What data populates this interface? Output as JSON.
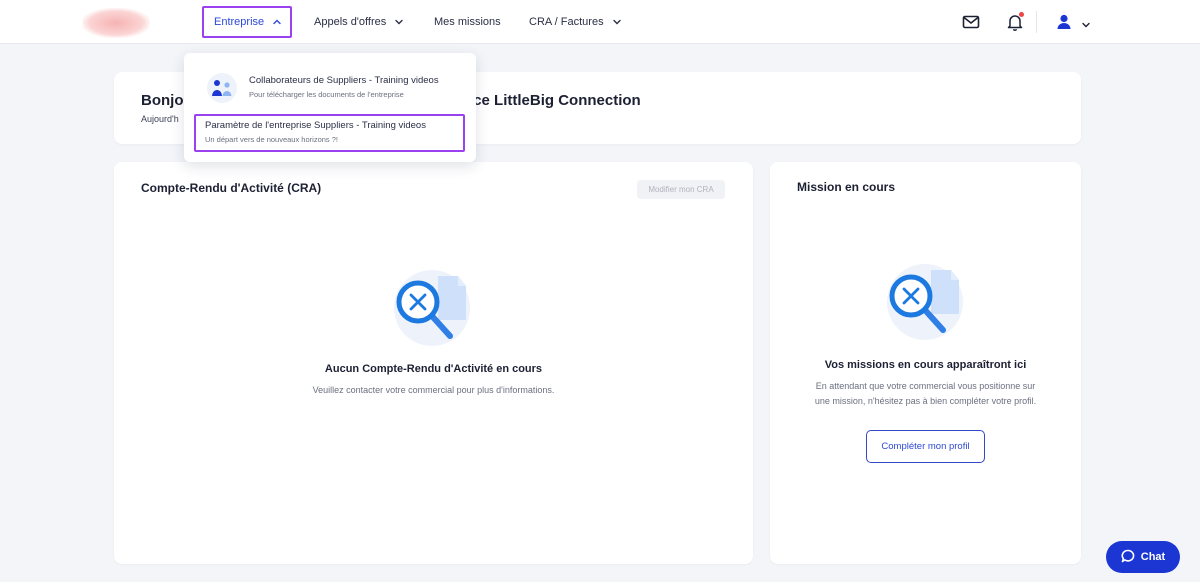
{
  "nav": {
    "items": [
      {
        "label": "Entreprise",
        "active": true
      },
      {
        "label": "Appels d'offres"
      },
      {
        "label": "Mes missions"
      },
      {
        "label": "CRA / Factures"
      }
    ]
  },
  "dropdown": {
    "items": [
      {
        "title": "Collaborateurs de Suppliers - Training videos",
        "subtitle": "Pour télécharger les documents de l'entreprise"
      },
      {
        "title": "Paramètre de l'entreprise Suppliers - Training videos",
        "subtitle": "Un départ vers de nouveaux horizons ?!"
      }
    ]
  },
  "welcome": {
    "title_start": "Bonjo",
    "title_end": "espace LittleBig Connection",
    "subtitle_start": "Aujourd'h"
  },
  "cra": {
    "title": "Compte-Rendu d'Activité (CRA)",
    "modify_button": "Modifier mon CRA",
    "empty_title": "Aucun Compte-Rendu d'Activité en cours",
    "empty_text": "Veuillez contacter votre commercial pour plus d'informations."
  },
  "mission": {
    "title": "Mission en cours",
    "empty_title": "Vos missions en cours apparaîtront ici",
    "empty_text_line1": "En attendant que votre commercial vous positionne sur",
    "empty_text_line2": "une mission, n'hésitez pas à bien compléter votre profil.",
    "profile_button": "Compléter mon profil"
  },
  "chat": {
    "label": "Chat"
  },
  "colors": {
    "accent": "#2d49d6",
    "highlight_border": "#9b41f0",
    "chat_bg": "#1b36d3",
    "page_bg": "#f3f5f9"
  },
  "icons": {
    "logo": "company-logo",
    "mail": "mail-icon",
    "bell": "bell-icon",
    "user": "user-icon",
    "search_empty": "magnifier-x-icon",
    "chat": "chat-bubble-icon"
  }
}
